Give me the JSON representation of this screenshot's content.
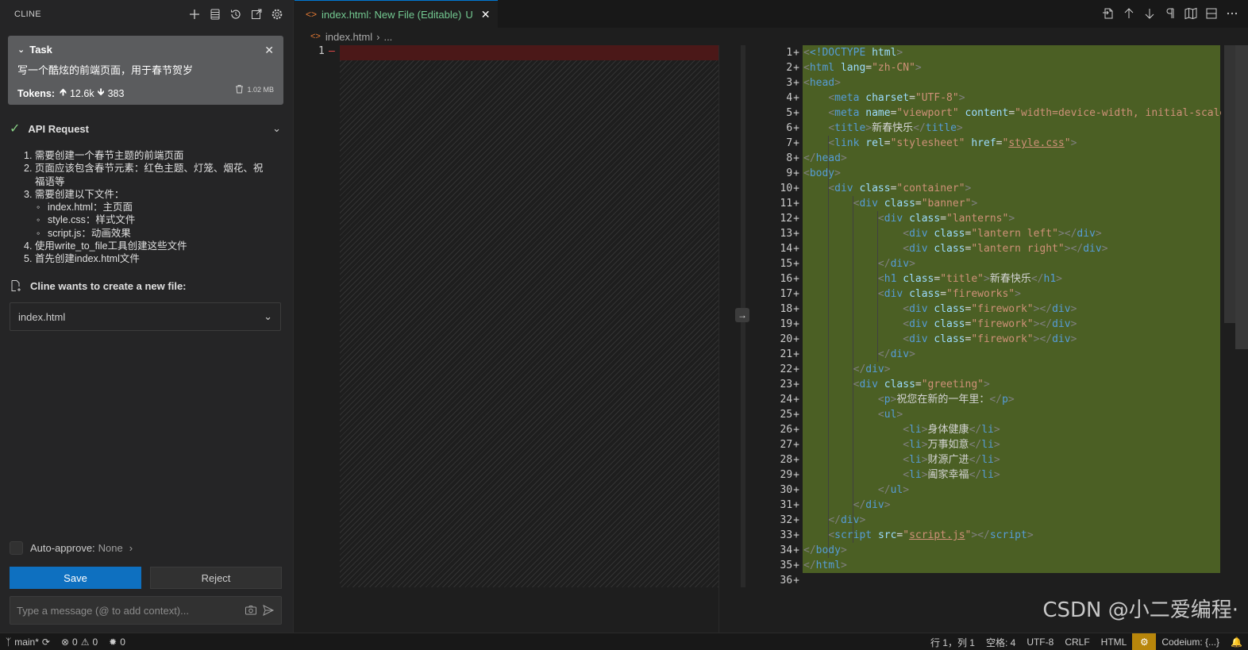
{
  "sidebar": {
    "title": "CLINE",
    "task": {
      "label": "Task",
      "text": "写一个酷炫的前端页面，用于春节贺岁",
      "tokens_label": "Tokens:",
      "tokens_in": "12.6k",
      "tokens_out": "383",
      "size": "1.02 MB"
    },
    "api_request": {
      "label": "API Request"
    },
    "steps": [
      "1. 需要创建一个春节主题的前端页面",
      "2. 页面应该包含春节元素：红色主题、灯笼、烟花、祝",
      "福语等",
      "3. 需要创建以下文件：",
      "index.html：主页面",
      "style.css：样式文件",
      "script.js：动画效果",
      "4. 使用write_to_file工具创建这些文件",
      "5. 首先创建index.html文件"
    ],
    "create_label": "Cline wants to create a new file:",
    "file_selected": "index.html",
    "auto_approve": {
      "label": "Auto-approve:",
      "value": "None"
    },
    "save_label": "Save",
    "reject_label": "Reject",
    "message_placeholder": "Type a message (@ to add context)..."
  },
  "editor": {
    "tab_label": "index.html: New File (Editable)",
    "tab_status": "U",
    "breadcrumb_file": "index.html",
    "breadcrumb_more": "...",
    "left_line_number": "1",
    "line_numbers": [
      "1",
      "2",
      "3",
      "4",
      "5",
      "6",
      "7",
      "8",
      "9",
      "10",
      "11",
      "12",
      "13",
      "14",
      "15",
      "16",
      "17",
      "18",
      "19",
      "20",
      "21",
      "22",
      "23",
      "24",
      "25",
      "26",
      "27",
      "28",
      "29",
      "30",
      "31",
      "32",
      "33",
      "34",
      "35",
      "36"
    ],
    "code": {
      "l1_doctype": "<!DOCTYPE",
      "l1_html": "html",
      "l2_lang_val": "\"zh-CN\"",
      "l5_content_val": "\"width=device-width, initial-scale=",
      "l6_title": "新春快乐",
      "l16_title": "新春快乐",
      "l24_text": "祝您在新的一年里：",
      "l26": "身体健康",
      "l27": "万事如意",
      "l28": "财源广进",
      "l29": "阖家幸福"
    },
    "watermark": "CSDN @小二爱编程·"
  },
  "statusbar": {
    "branch": "main*",
    "errors": "0",
    "warnings": "0",
    "ports": "0",
    "position": "行 1，列 1",
    "spaces": "空格: 4",
    "encoding": "UTF-8",
    "eol": "CRLF",
    "language": "HTML",
    "codeium": "Codeium: {...}"
  }
}
